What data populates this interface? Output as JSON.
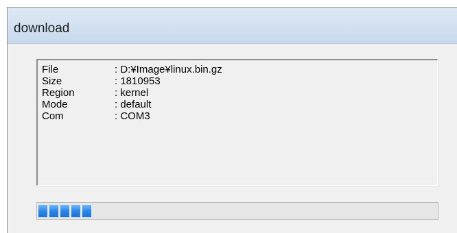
{
  "window": {
    "title": "download"
  },
  "info": [
    {
      "key": "File",
      "value": "D:¥Image¥linux.bin.gz"
    },
    {
      "key": "Size",
      "value": "1810953"
    },
    {
      "key": "Region",
      "value": "kernel"
    },
    {
      "key": "Mode",
      "value": "default"
    },
    {
      "key": "Com",
      "value": "COM3"
    }
  ],
  "progress": {
    "filled_blocks": 5,
    "fraction": 0.14,
    "color": "#2b86e6"
  }
}
